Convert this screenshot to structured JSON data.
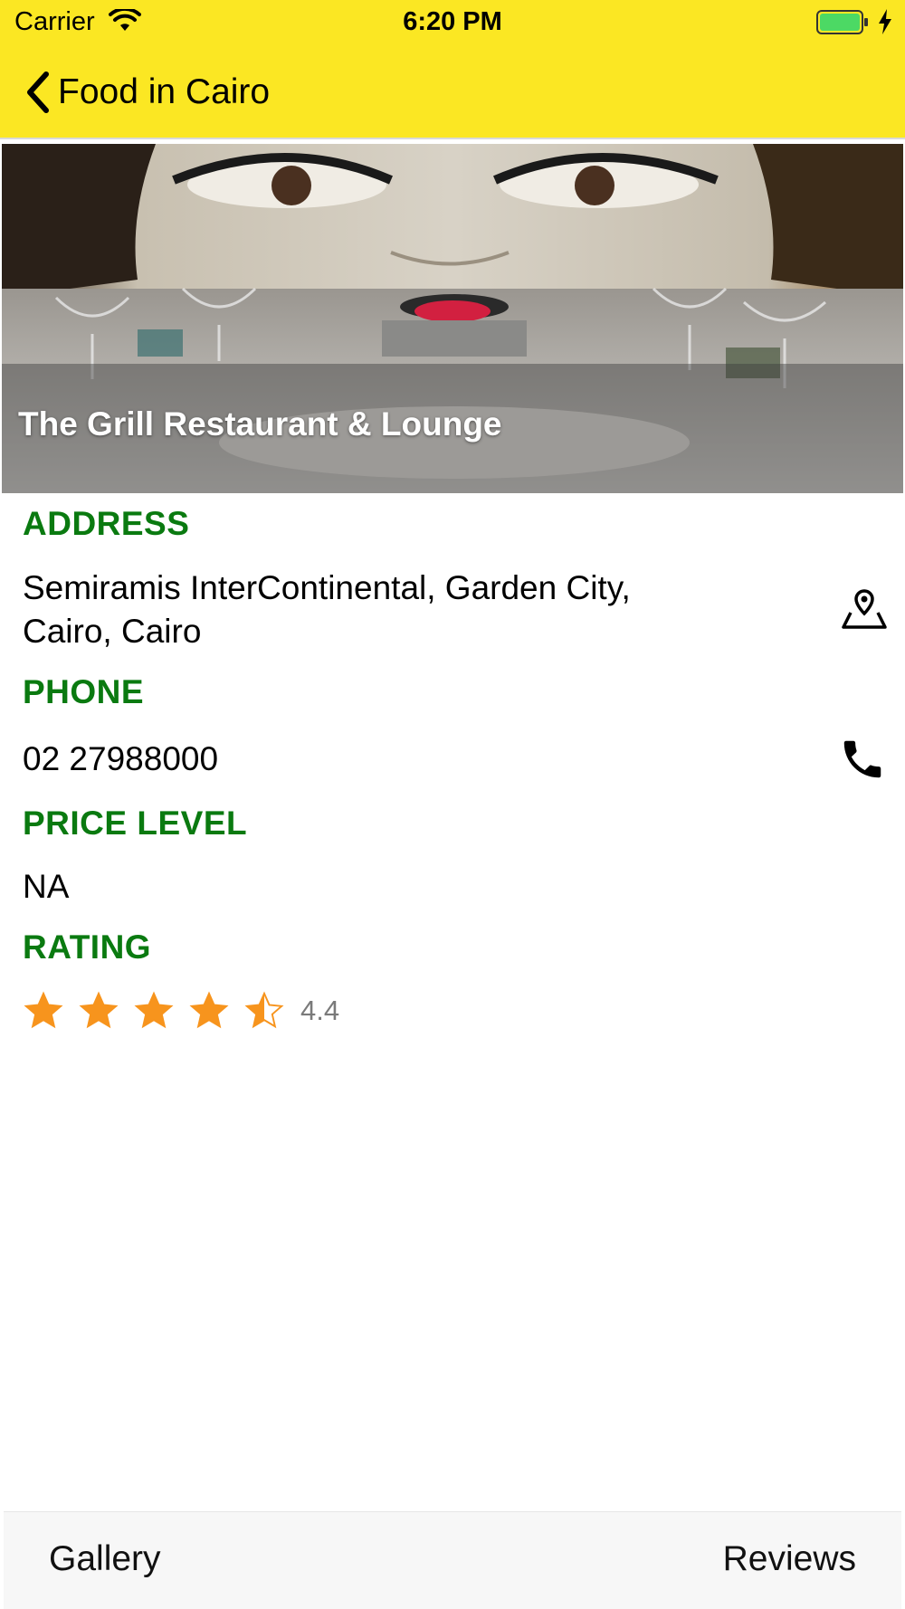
{
  "status_bar": {
    "carrier": "Carrier",
    "time": "6:20 PM"
  },
  "nav": {
    "back_label": "Food in Cairo"
  },
  "restaurant": {
    "name": "The Grill Restaurant & Lounge"
  },
  "details": {
    "address_label": "ADDRESS",
    "address_line1": "Semiramis InterContinental, Garden City,",
    "address_line2": "Cairo, Cairo",
    "phone_label": "PHONE",
    "phone": "02 27988000",
    "price_label": "PRICE LEVEL",
    "price": "NA",
    "rating_label": "RATING",
    "rating": 4.4,
    "rating_text": "4.4"
  },
  "bottom_bar": {
    "gallery_label": "Gallery",
    "reviews_label": "Reviews"
  },
  "colors": {
    "header": "#fbe723",
    "section_label": "#0a7a10",
    "star": "#f7941d"
  },
  "icons": [
    "wifi-icon",
    "battery-icon",
    "charging-icon",
    "back-chevron-icon",
    "map-pin-icon",
    "phone-icon",
    "star-icon"
  ]
}
